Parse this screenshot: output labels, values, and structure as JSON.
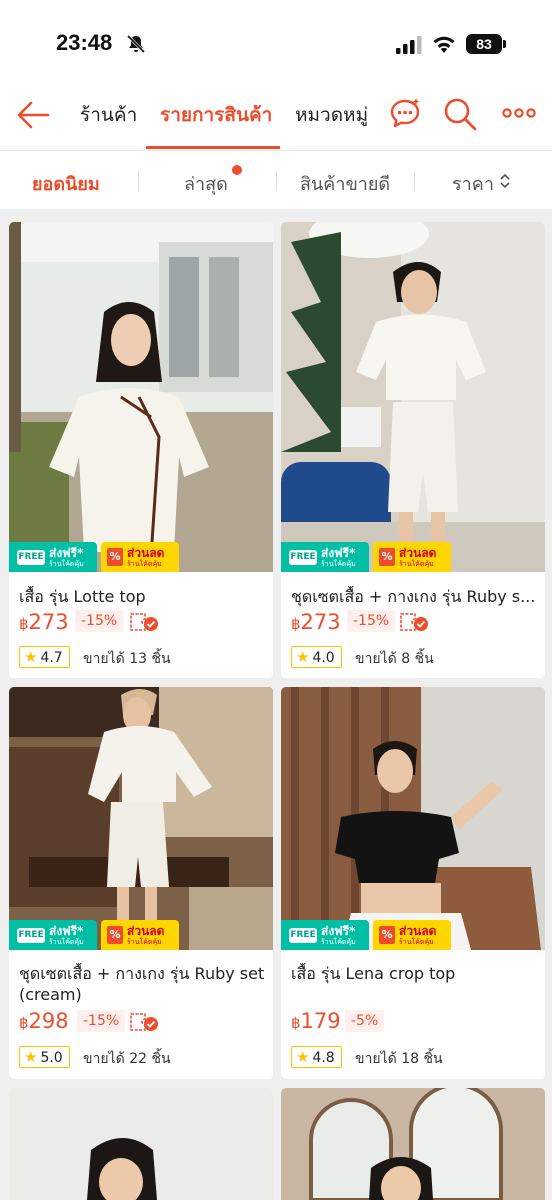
{
  "status_bar": {
    "time": "23:48",
    "battery": "83"
  },
  "nav": {
    "tabs": [
      {
        "label": "ร้านค้า"
      },
      {
        "label": "รายการสินค้า"
      },
      {
        "label": "หมวดหมู่"
      }
    ],
    "active_tab": "รายการสินค้า"
  },
  "sort": {
    "items": [
      {
        "label": "ยอดนิยม"
      },
      {
        "label": "ล่าสุด"
      },
      {
        "label": "สินค้าขายดี"
      },
      {
        "label": "ราคา"
      }
    ],
    "active": "ยอดนิยม"
  },
  "badges": {
    "ship_free_tag": "FREE",
    "ship_label": "ส่งฟรี*",
    "ship_sub": "ร้านโค้ดคุ้ม",
    "discount_icon": "%",
    "discount_label": "ส่วนลด",
    "discount_sub": "ร้านโค้ดคุ้ม"
  },
  "products": [
    {
      "title": "เสื้อ รุ่น Lotte top",
      "currency": "฿",
      "price": "273",
      "discount": "-15%",
      "rating": "4.7",
      "sold": "ขายได้ 13 ชิ้น"
    },
    {
      "title": "ชุดเซตเสื้อ + กางเกง รุ่น Ruby s...",
      "currency": "฿",
      "price": "273",
      "discount": "-15%",
      "rating": "4.0",
      "sold": "ขายได้ 8 ชิ้น"
    },
    {
      "title": "ชุดเซตเสื้อ + กางเกง รุ่น Ruby set (cream)",
      "currency": "฿",
      "price": "298",
      "discount": "-15%",
      "rating": "5.0",
      "sold": "ขายได้ 22 ชิ้น"
    },
    {
      "title": "เสื้อ รุ่น Lena crop top",
      "currency": "฿",
      "price": "179",
      "discount": "-5%",
      "rating": "4.8",
      "sold": "ขายได้ 18 ชิ้น"
    }
  ],
  "colors": {
    "accent": "#ee4d2d",
    "ship_badge": "#00bfa5",
    "discount_badge": "#ffd600",
    "rating_star": "#ffc400"
  }
}
